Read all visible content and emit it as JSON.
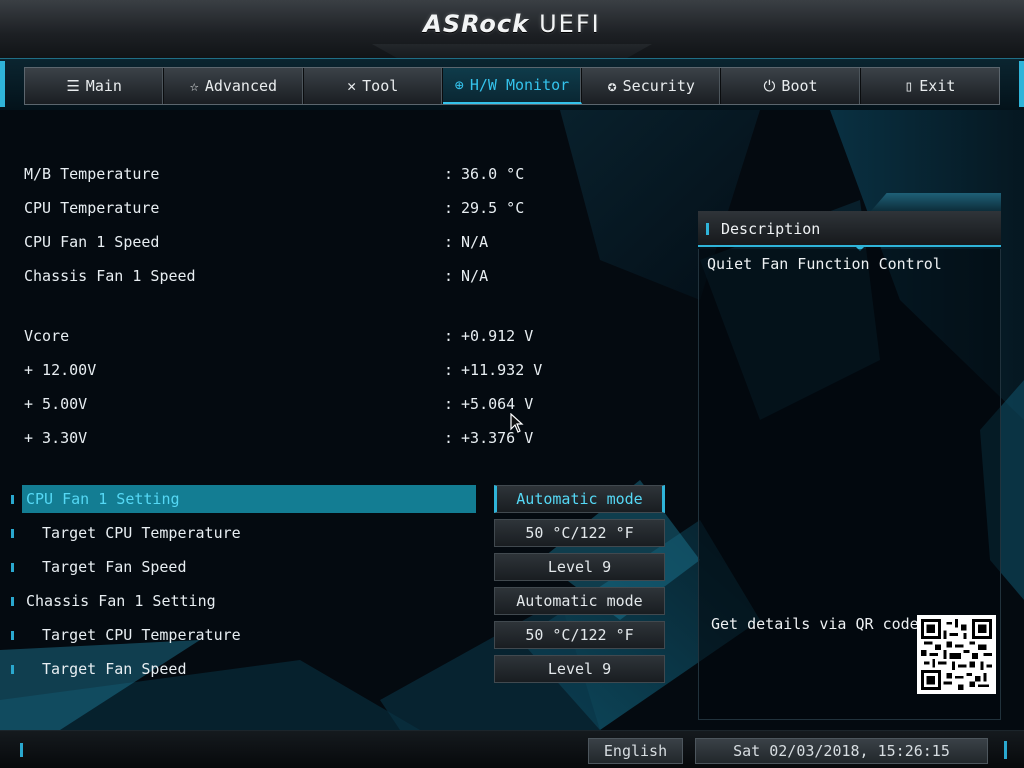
{
  "header": {
    "brand": "ASRock",
    "product": "UEFI"
  },
  "tabs": [
    {
      "label": "Main",
      "icon": "list-icon"
    },
    {
      "label": "Advanced",
      "icon": "star-icon"
    },
    {
      "label": "Tool",
      "icon": "tools-icon"
    },
    {
      "label": "H/W Monitor",
      "icon": "globe-icon",
      "active": true
    },
    {
      "label": "Security",
      "icon": "shield-icon"
    },
    {
      "label": "Boot",
      "icon": "power-icon"
    },
    {
      "label": "Exit",
      "icon": "exit-icon"
    }
  ],
  "monitor": {
    "temps": [
      {
        "label": "M/B Temperature",
        "value": "36.0 °C"
      },
      {
        "label": "CPU Temperature",
        "value": "29.5 °C"
      },
      {
        "label": "CPU Fan 1 Speed",
        "value": "N/A"
      },
      {
        "label": "Chassis Fan 1 Speed",
        "value": "N/A"
      }
    ],
    "voltages": [
      {
        "label": "Vcore",
        "value": "+0.912 V"
      },
      {
        "label": "+ 12.00V",
        "value": "+11.932 V"
      },
      {
        "label": "+ 5.00V",
        "value": "+5.064 V"
      },
      {
        "label": "+ 3.30V",
        "value": "+3.376 V"
      }
    ],
    "separator": ":"
  },
  "settings": [
    {
      "label": "CPU Fan 1 Setting",
      "value": "Automatic mode",
      "selected": true
    },
    {
      "label": "Target CPU Temperature",
      "value": "50 °C/122 °F",
      "sub": true
    },
    {
      "label": "Target Fan Speed",
      "value": "Level 9",
      "sub": true
    },
    {
      "label": "Chassis Fan 1 Setting",
      "value": "Automatic mode"
    },
    {
      "label": "Target CPU Temperature",
      "value": "50 °C/122 °F",
      "sub": true
    },
    {
      "label": "Target Fan Speed",
      "value": "Level 9",
      "sub": true
    }
  ],
  "description": {
    "title": "Description",
    "text": "Quiet Fan Function Control",
    "qr_label": "Get details via QR code"
  },
  "footer": {
    "language": "English",
    "datetime": "Sat 02/03/2018, 15:26:15"
  },
  "colors": {
    "accent": "#2fb4d9",
    "selected_row": "#137d93",
    "background": "#050a10"
  }
}
